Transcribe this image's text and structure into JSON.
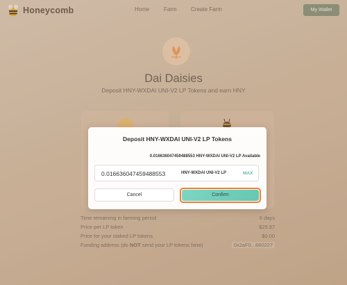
{
  "header": {
    "brand": "Honeycomb",
    "nav": [
      "Home",
      "Farm",
      "Create Farm"
    ],
    "wallet_button": "My Wallet"
  },
  "hero": {
    "title": "Dai Daisies",
    "subtitle": "Deposit HNY-WXDAI UNI-V2 LP Tokens and earn HNY"
  },
  "info": [
    {
      "label": "Time remaining in farming period",
      "value": "6 days"
    },
    {
      "label": "Price per LP token",
      "value": "$29.97"
    },
    {
      "label": "Price for your staked LP tokens",
      "value": "$0.00"
    },
    {
      "label_prefix": "Funding address (do ",
      "label_emph": "NOT",
      "label_suffix": " send your LP tokens here)",
      "value": "0x2aF0...660227"
    }
  ],
  "modal": {
    "title": "Deposit HNY-WXDAI UNI-V2 LP Tokens",
    "available_amount": "0.016636047459488553",
    "available_suffix": " HNY-WXDAI UNI-V2 LP Available",
    "input_value": "0.016636047459488553",
    "token_label": "HNY-WXDAI UNI-V2 LP",
    "max_label": "MAX",
    "cancel_label": "Cancel",
    "confirm_label": "Confirm"
  },
  "colors": {
    "accent": "#66c8b3",
    "focus_outline": "#ef7f2c",
    "wallet_button": "#8a907a"
  },
  "icons": [
    "bee-logo-icon",
    "flower-icon",
    "token-icon"
  ]
}
